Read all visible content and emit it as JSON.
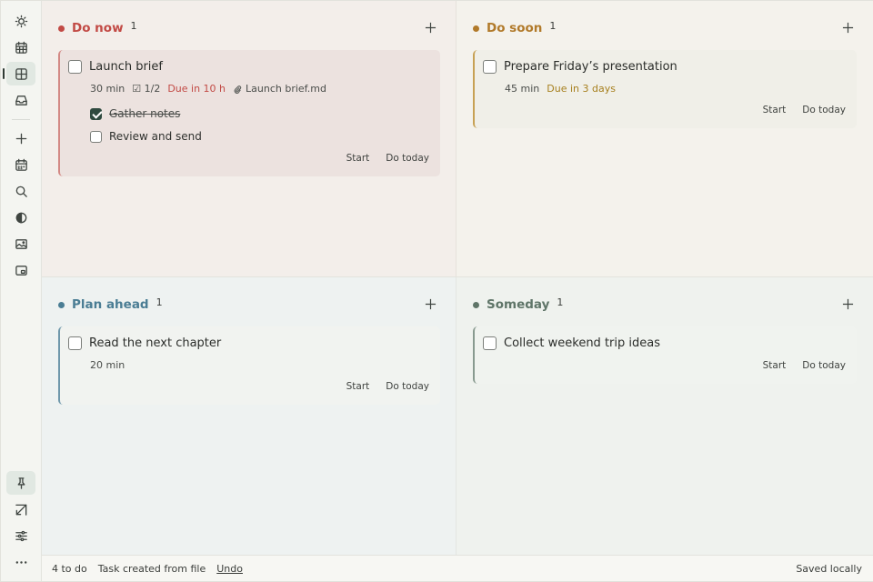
{
  "sidebar": {
    "top": [
      {
        "name": "sun-icon"
      },
      {
        "name": "calendar-icon"
      },
      {
        "name": "grid-icon",
        "active": true
      },
      {
        "name": "inbox-icon"
      }
    ],
    "middle": [
      {
        "name": "plus-icon"
      },
      {
        "name": "calendar-week-icon"
      },
      {
        "name": "search-icon"
      },
      {
        "name": "contrast-icon"
      },
      {
        "name": "image-icon"
      },
      {
        "name": "picture-in-picture-icon"
      }
    ],
    "bottom": [
      {
        "name": "pin-icon",
        "active": true
      },
      {
        "name": "resize-icon"
      },
      {
        "name": "sliders-icon"
      },
      {
        "name": "more-icon"
      }
    ]
  },
  "quadrants": {
    "now": {
      "title": "Do now",
      "count": "1",
      "color": "#c24a45",
      "border": "#d38985",
      "card_bg": "#ece2df",
      "card": {
        "title": "Launch brief",
        "duration": "30 min",
        "subtasks": "☑ 1/2",
        "due": "Due in 10 h",
        "due_color": "#c24a45",
        "attachment": "Launch brief.md",
        "checklist": [
          {
            "label": "Gather notes",
            "done": true
          },
          {
            "label": "Review and send",
            "done": false
          }
        ],
        "start": "Start",
        "today": "Do today"
      }
    },
    "soon": {
      "title": "Do soon",
      "count": "1",
      "color": "#b17a2a",
      "border": "#c7a154",
      "card_bg": "#f0efe8",
      "card": {
        "title": "Prepare Friday’s presentation",
        "duration": "45 min",
        "due": "Due in 3 days",
        "due_color": "#a7801f",
        "start": "Start",
        "today": "Do today"
      }
    },
    "plan": {
      "title": "Plan ahead",
      "count": "1",
      "color": "#4a7d94",
      "border": "#6f98ab",
      "card_bg": "#f1f3f0",
      "card": {
        "title": "Read the next chapter",
        "duration": "20 min",
        "start": "Start",
        "today": "Do today"
      }
    },
    "some": {
      "title": "Someday",
      "count": "1",
      "color": "#5f7568",
      "border": "#889a8f",
      "card_bg": "#f0f3ef",
      "card": {
        "title": "Collect weekend trip ideas",
        "start": "Start",
        "today": "Do today"
      }
    }
  },
  "status": {
    "todo": "4 to do",
    "message": "Task created from file",
    "undo": "Undo",
    "saved": "Saved locally"
  }
}
